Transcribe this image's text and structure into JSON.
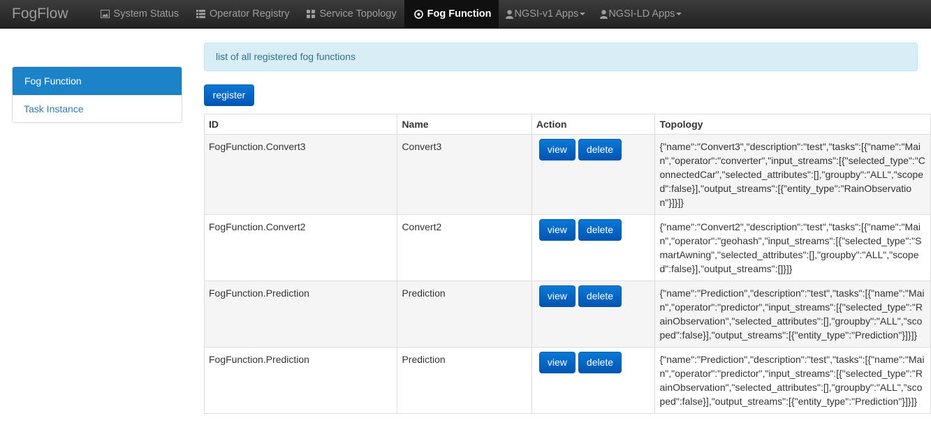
{
  "brand": "FogFlow",
  "nav": [
    {
      "label": "System Status",
      "icon": "image-icon",
      "active": false,
      "caret": false
    },
    {
      "label": "Operator Registry",
      "icon": "list-icon",
      "active": false,
      "caret": false
    },
    {
      "label": "Service Topology",
      "icon": "grid-icon",
      "active": false,
      "caret": false
    },
    {
      "label": "Fog Function",
      "icon": "target-icon",
      "active": true,
      "caret": false
    },
    {
      "label": "NGSI-v1 Apps",
      "icon": "user-icon",
      "active": false,
      "caret": true
    },
    {
      "label": "NGSI-LD Apps",
      "icon": "user-icon",
      "active": false,
      "caret": true
    }
  ],
  "sidebar": {
    "items": [
      {
        "label": "Fog Function",
        "active": true
      },
      {
        "label": "Task Instance",
        "active": false
      }
    ]
  },
  "info_text": "list of all registered fog functions",
  "register_label": "register",
  "table": {
    "headers": [
      "ID",
      "Name",
      "Action",
      "Topology"
    ],
    "view_label": "view",
    "delete_label": "delete",
    "rows": [
      {
        "id": "FogFunction.Convert3",
        "name": "Convert3",
        "topology": "{\"name\":\"Convert3\",\"description\":\"test\",\"tasks\":[{\"name\":\"Main\",\"operator\":\"converter\",\"input_streams\":[{\"selected_type\":\"ConnectedCar\",\"selected_attributes\":[],\"groupby\":\"ALL\",\"scoped\":false}],\"output_streams\":[{\"entity_type\":\"RainObservation\"}]}]}"
      },
      {
        "id": "FogFunction.Convert2",
        "name": "Convert2",
        "topology": "{\"name\":\"Convert2\",\"description\":\"test\",\"tasks\":[{\"name\":\"Main\",\"operator\":\"geohash\",\"input_streams\":[{\"selected_type\":\"SmartAwning\",\"selected_attributes\":[],\"groupby\":\"ALL\",\"scoped\":false}],\"output_streams\":[]}]}"
      },
      {
        "id": "FogFunction.Prediction",
        "name": "Prediction",
        "topology": "{\"name\":\"Prediction\",\"description\":\"test\",\"tasks\":[{\"name\":\"Main\",\"operator\":\"predictor\",\"input_streams\":[{\"selected_type\":\"RainObservation\",\"selected_attributes\":[],\"groupby\":\"ALL\",\"scoped\":false}],\"output_streams\":[{\"entity_type\":\"Prediction\"}]}]}"
      },
      {
        "id": "FogFunction.Prediction",
        "name": "Prediction",
        "topology": "{\"name\":\"Prediction\",\"description\":\"test\",\"tasks\":[{\"name\":\"Main\",\"operator\":\"predictor\",\"input_streams\":[{\"selected_type\":\"RainObservation\",\"selected_attributes\":[],\"groupby\":\"ALL\",\"scoped\":false}],\"output_streams\":[{\"entity_type\":\"Prediction\"}]}]}"
      }
    ]
  }
}
